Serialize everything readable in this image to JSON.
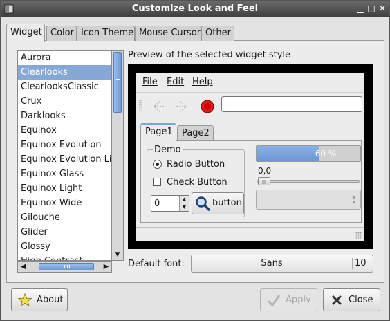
{
  "window": {
    "title": "Customize Look and Feel"
  },
  "tabs": [
    "Widget",
    "Color",
    "Icon Theme",
    "Mouse Cursor",
    "Other"
  ],
  "theme_list": {
    "items": [
      "Aurora",
      "Clearlooks",
      "ClearlooksClassic",
      "Crux",
      "Darklooks",
      "Equinox",
      "Equinox Evolution",
      "Equinox Evolution Lig",
      "Equinox Glass",
      "Equinox Light",
      "Equinox Wide",
      "Gilouche",
      "Glider",
      "Glossy",
      "High Contrast"
    ],
    "selected": "Clearlooks"
  },
  "preview": {
    "label": "Preview of the selected widget style",
    "menu": [
      "File",
      "Edit",
      "Help"
    ],
    "tabs": [
      "Page1",
      "Page2"
    ],
    "frame_label": "Demo",
    "radio_label": "Radio Button",
    "check_label": "Check Button",
    "spin_value": "0",
    "button_label": "button",
    "progress_text": "60 %",
    "progress_fraction": 0.6,
    "scale_value": "0,0",
    "icons": {
      "back": "back-arrow-icon",
      "forward": "forward-arrow-icon",
      "stop": "stop-icon",
      "find": "magnifier-icon"
    }
  },
  "font": {
    "label": "Default font:",
    "name": "Sans",
    "size": "10"
  },
  "buttons": {
    "about": "About",
    "apply": "Apply",
    "close": "Close"
  },
  "colors": {
    "selection": "#86a8d6",
    "titlebar": "#4f4f4f",
    "accent": "#6f98d4",
    "stop": "#e01b1b"
  }
}
